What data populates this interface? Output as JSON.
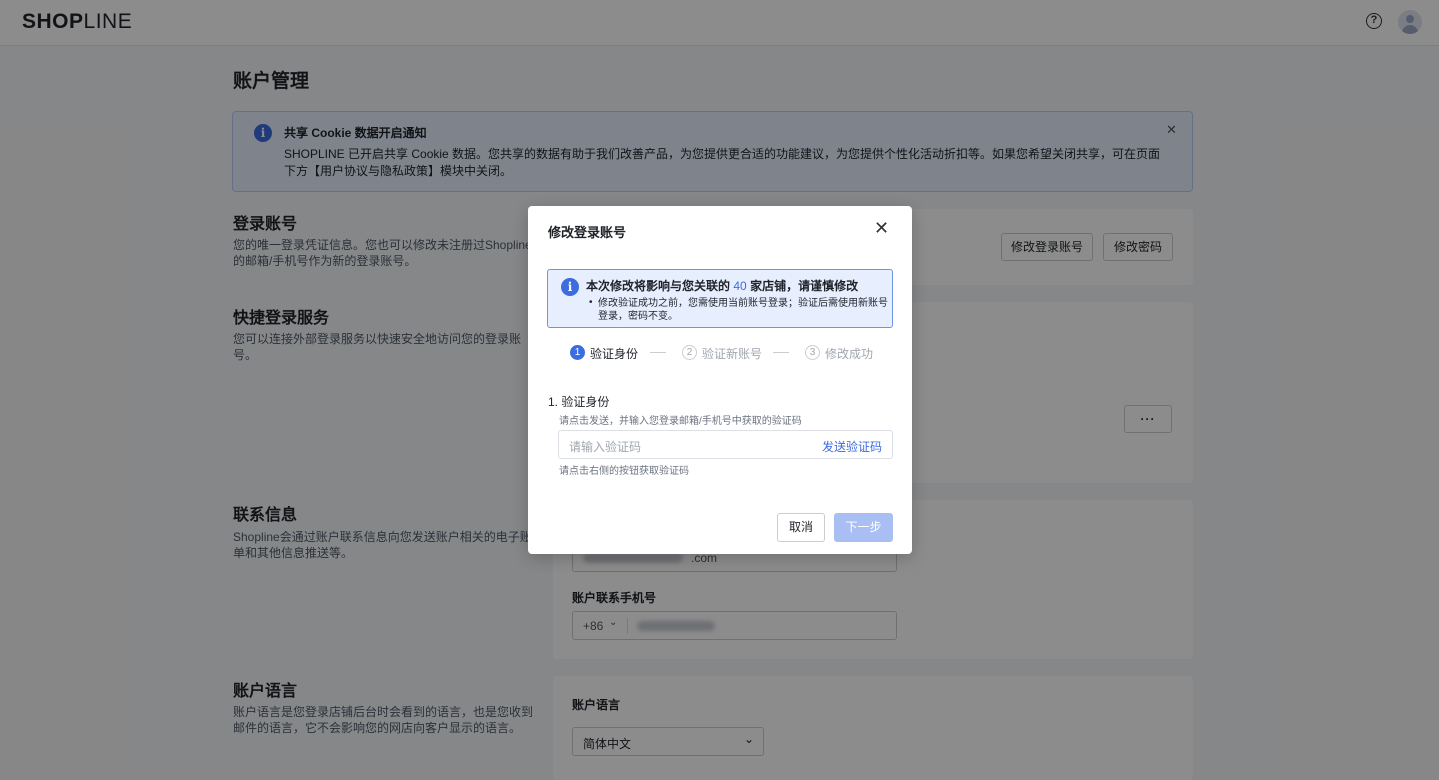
{
  "topbar": {
    "logo_a": "SHOP",
    "logo_b": "LINE",
    "help_icon": "question-circle-icon",
    "avatar_icon": "user-avatar-icon"
  },
  "page": {
    "title": "账户管理"
  },
  "notice": {
    "title": "共享 Cookie 数据开启通知",
    "text": "SHOPLINE 已开启共享 Cookie 数据。您共享的数据有助于我们改善产品，为您提供更合适的功能建议，为您提供个性化活动折扣等。如果您希望关闭共享，可在页面下方【用户协议与隐私政策】模块中关闭。",
    "info_glyph": "i",
    "close_glyph": "✕"
  },
  "login_account": {
    "title": "登录账号",
    "desc": "您的唯一登录凭证信息。您也可以修改未注册过Shopline的邮箱/手机号作为新的登录账号。",
    "change_account_button": "修改登录账号",
    "change_password_button": "修改密码"
  },
  "quick_login": {
    "title": "快捷登录服务",
    "desc": "您可以连接外部登录服务以快速安全地访问您的登录账号。",
    "more_glyph": "···"
  },
  "contact": {
    "title": "联系信息",
    "desc": "Shopline会通过账户联系信息向您发送账户相关的电子账单和其他信息推送等。",
    "email_suffix": ".com",
    "phone_label": "账户联系手机号",
    "phone_code": "+86"
  },
  "language": {
    "title": "账户语言",
    "desc": "账户语言是您登录店铺后台时会看到的语言，也是您收到邮件的语言，它不会影响您的网店向客户显示的语言。",
    "field_label": "账户语言",
    "selected": "简体中文"
  },
  "modal": {
    "title": "修改登录账号",
    "close_glyph": "✕",
    "warning": {
      "title_prefix": "本次修改将影响与您关联的",
      "count": "40",
      "title_suffix": "家店铺，请谨慎修改",
      "text": "修改验证成功之前，您需使用当前账号登录；验证后需使用新账号登录，密码不变。"
    },
    "steps": [
      {
        "num": "1",
        "label": "验证身份",
        "state": "active"
      },
      {
        "num": "2",
        "label": "验证新账号",
        "state": "idle"
      },
      {
        "num": "3",
        "label": "修改成功",
        "state": "idle"
      }
    ],
    "section_title": "1. 验证身份",
    "section_hint": "请点击发送，并输入您登录邮箱/手机号中获取的验证码",
    "code_placeholder": "请输入验证码",
    "send_code": "发送验证码",
    "input_hint": "请点击右侧的按钮获取验证码",
    "cancel_button": "取消",
    "next_button": "下一步"
  }
}
